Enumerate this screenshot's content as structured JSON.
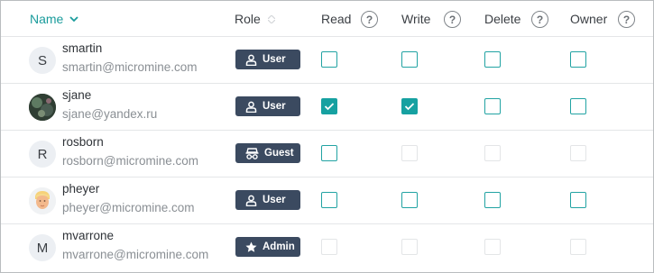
{
  "columns": {
    "name": "Name",
    "role": "Role",
    "read": "Read",
    "write": "Write",
    "delete": "Delete",
    "owner": "Owner",
    "help_glyph": "?"
  },
  "users": [
    {
      "username": "smartin",
      "email": "smartin@micromine.com",
      "avatar_letter": "S",
      "role": "User",
      "role_icon": "person-icon",
      "read": false,
      "write": false,
      "delete": false,
      "owner": false,
      "enabled": [
        true,
        true,
        true,
        true
      ]
    },
    {
      "username": "sjane",
      "email": "sjane@yandex.ru",
      "avatar_letter": "",
      "role": "User",
      "role_icon": "person-icon",
      "read": true,
      "write": true,
      "delete": false,
      "owner": false,
      "enabled": [
        true,
        true,
        true,
        true
      ]
    },
    {
      "username": "rosborn",
      "email": "rosborn@micromine.com",
      "avatar_letter": "R",
      "role": "Guest",
      "role_icon": "incognito-icon",
      "read": false,
      "write": false,
      "delete": false,
      "owner": false,
      "enabled": [
        true,
        false,
        false,
        false
      ]
    },
    {
      "username": "pheyer",
      "email": "pheyer@micromine.com",
      "avatar_letter": "",
      "role": "User",
      "role_icon": "person-icon",
      "read": false,
      "write": false,
      "delete": false,
      "owner": false,
      "enabled": [
        true,
        true,
        true,
        true
      ]
    },
    {
      "username": "mvarrone",
      "email": "mvarrone@micromine.com",
      "avatar_letter": "M",
      "role": "Admin",
      "role_icon": "star-icon",
      "read": false,
      "write": false,
      "delete": false,
      "owner": false,
      "enabled": [
        false,
        false,
        false,
        false
      ]
    }
  ],
  "colors": {
    "accent": "#16a1a1",
    "badge": "#3b4a60",
    "border": "#e4e6e8"
  }
}
